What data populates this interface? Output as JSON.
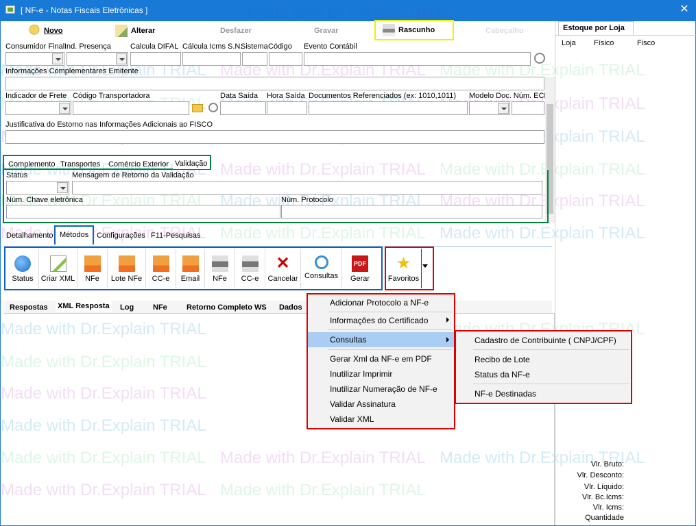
{
  "window": {
    "title": "[ NF-e - Notas Fiscais Eletrônicas ]",
    "close": "✕"
  },
  "toolbar": {
    "novo": "Novo",
    "alterar": "Alterar",
    "desfazer": "Desfazer",
    "gravar": "Gravar",
    "rascunho": "Rascunho",
    "cabecalho": "Cabeçalho"
  },
  "estoque": {
    "title": "Estoque por Loja",
    "cols": [
      "Loja",
      "Físico",
      "Fisco"
    ]
  },
  "fields": {
    "consumidor_final": "Consumidor Final",
    "ind_presenca": "Ind. Presença",
    "calcula_difal": "Calcula DIFAL",
    "calcula_icms": "Cálcula Icms S.N.",
    "sistema": "Sistema",
    "codigo": "Código",
    "evento_contabil": "Evento Contábil",
    "info_comp": "Informações Complementares Emitente",
    "indicador_frete": "Indicador de Frete",
    "cod_transportadora": "Código Transportadora",
    "data_saida": "Data Saída",
    "hora_saida": "Hora Saída",
    "docs_ref": "Documentos Referenciados (ex: 1010,1011)",
    "modelo_doc": "Modelo Doc. Núm. ECF",
    "justificativa": "Justificativa do Estorno nas Informações Adicionais ao FISCO"
  },
  "tabs1": [
    "Complemento",
    "Transportes",
    "Comércio Exterior",
    "Validação"
  ],
  "validacao": {
    "status": "Status",
    "mensagem": "Mensagem de Retorno da Validação",
    "chave": "Núm. Chave eletrônica",
    "protocolo": "Núm. Protocolo"
  },
  "tabs2": [
    "Detalhamento",
    "Métodos",
    "Configurações",
    "F11-Pesquisas"
  ],
  "metodos": [
    "Status",
    "Criar XML",
    "NFe",
    "Lote NFe",
    "CC-e",
    "Email",
    "NFe",
    "CC-e",
    "Cancelar",
    "Consultas",
    "Gerar",
    "Favoritos"
  ],
  "tabs3": [
    "Respostas",
    "XML Resposta",
    "Log",
    "NFe",
    "Retorno Completo WS",
    "Dados"
  ],
  "menu": [
    "Adicionar Protocolo a NF-e",
    "Informações do Certificado",
    "Consultas",
    "Gerar Xml da NF-e em PDF",
    "Inutilizar Imprimir",
    "Inutilizar Numeração de NF-e",
    "Validar Assinatura",
    "Validar XML"
  ],
  "submenu": [
    "Cadastro de Contribuinte ( CNPJ/CPF)",
    "Recibo de Lote",
    "Status da NF-e",
    "NF-e Destinadas"
  ],
  "totais": [
    "Vlr. Bruto:",
    "Vlr. Desconto:",
    "Vlr. Líquido:",
    "Vlr. Bc.Icms:",
    "Vlr. Icms:",
    "Quantidade"
  ],
  "watermark": "Made with Dr.Explain TRIAL",
  "colors": {
    "titlebar": "#1979d6",
    "highlight_yellow": "#f0f000",
    "green_frame": "#008040",
    "blue_frame": "#1060c0",
    "red_frame": "#e00000",
    "menu_select": "#a9cdf3"
  }
}
